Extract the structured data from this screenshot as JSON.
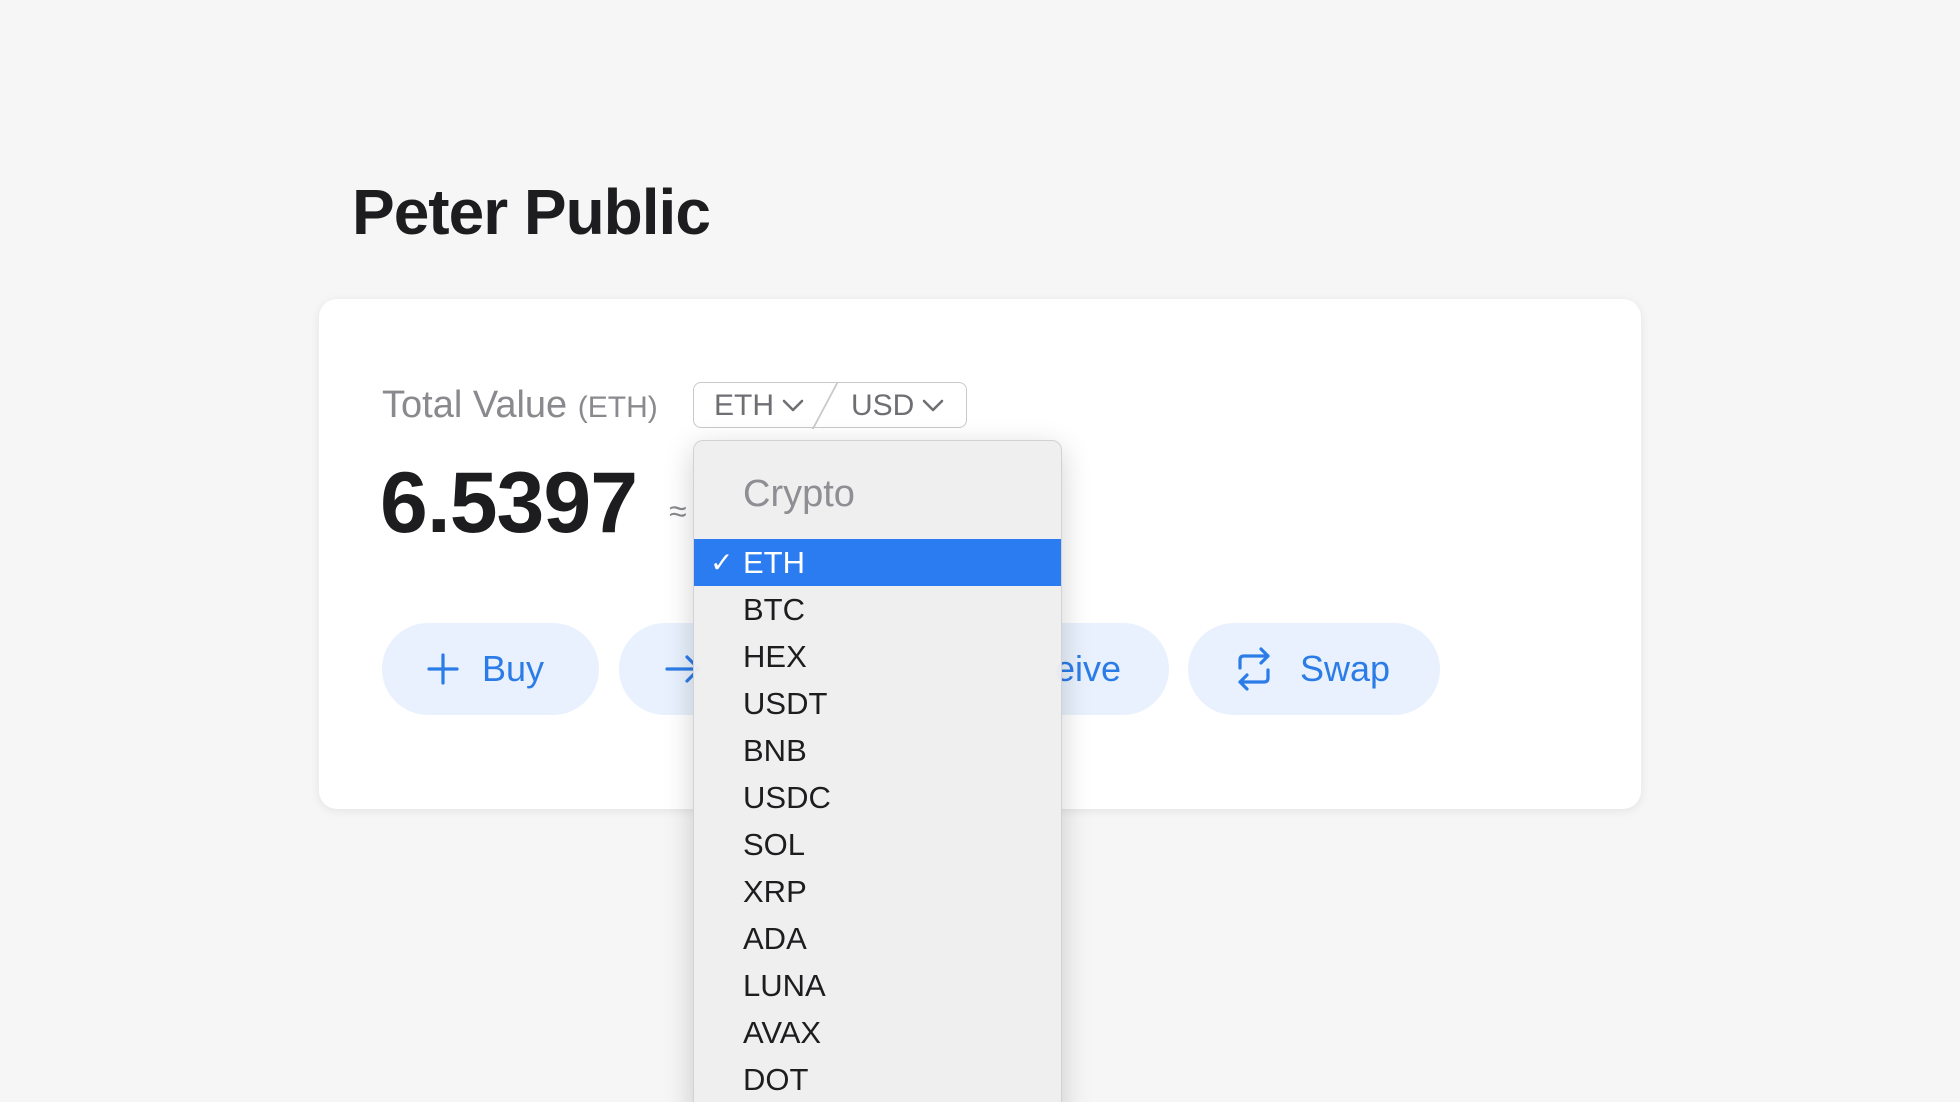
{
  "page": {
    "title": "Peter Public"
  },
  "summary": {
    "total_label": "Total Value",
    "total_unit": "(ETH)",
    "value": "6.5397",
    "approx_symbol": "≈"
  },
  "currency_toggle": {
    "crypto": "ETH",
    "fiat": "USD"
  },
  "actions": {
    "buy": "Buy",
    "receive_visible": "eive",
    "swap": "Swap"
  },
  "dropdown": {
    "header": "Crypto",
    "selected_mark": "✓",
    "items": [
      "ETH",
      "BTC",
      "HEX",
      "USDT",
      "BNB",
      "USDC",
      "SOL",
      "XRP",
      "ADA",
      "LUNA",
      "AVAX",
      "DOT"
    ],
    "selected": "ETH"
  },
  "colors": {
    "accent": "#2c7ce8",
    "button_bg": "#e8f1fd",
    "selection": "#2a7cf0"
  },
  "icons": {
    "buy": "plus-icon",
    "send": "arrow-right-icon",
    "swap": "swap-arrows-icon",
    "dropdown": "chevron-down-icon"
  }
}
